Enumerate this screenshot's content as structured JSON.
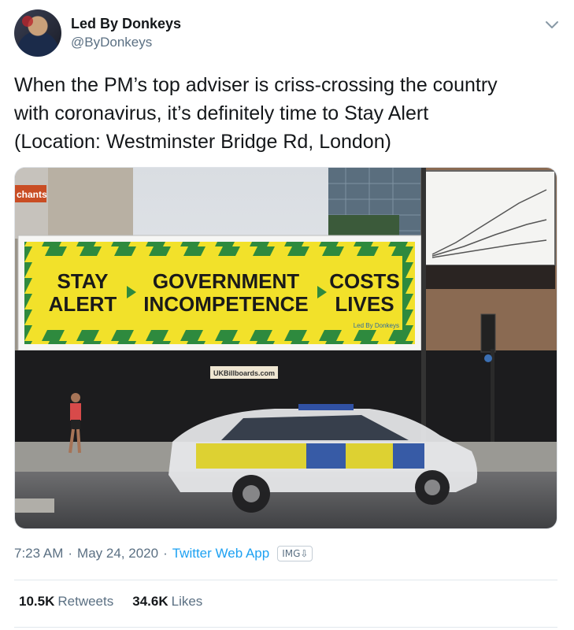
{
  "author": {
    "display_name": "Led By Donkeys",
    "handle": "@ByDonkeys"
  },
  "tweet": {
    "line1": "When the PM’s top adviser is criss-crossing the country",
    "line2": "with coronavirus, it’s definitely time to Stay Alert",
    "line3": "(Location: Westminster Bridge Rd, London)"
  },
  "billboard": {
    "col1_top": "STAY",
    "col1_bottom": "ALERT",
    "col2_top": "GOVERNMENT",
    "col2_bottom": "INCOMPETENCE",
    "col3_top": "COSTS",
    "col3_bottom": "LIVES",
    "credit": "Led By Donkeys",
    "owner_sign": "UKBillboards.com",
    "shop_sign": "chants"
  },
  "meta": {
    "time": "7:23 AM",
    "date": "May 24, 2020",
    "app": "Twitter Web App",
    "img_button": "IMG⇩"
  },
  "stats": {
    "retweets_count": "10.5K",
    "retweets_label": "Retweets",
    "likes_count": "34.6K",
    "likes_label": "Likes"
  },
  "colors": {
    "link": "#1da1f2",
    "muted": "#5b7083",
    "billboard_yellow": "#f2e12a",
    "billboard_green": "#2e8a3e"
  },
  "icons": [
    "chevron-down-icon",
    "download-icon"
  ]
}
